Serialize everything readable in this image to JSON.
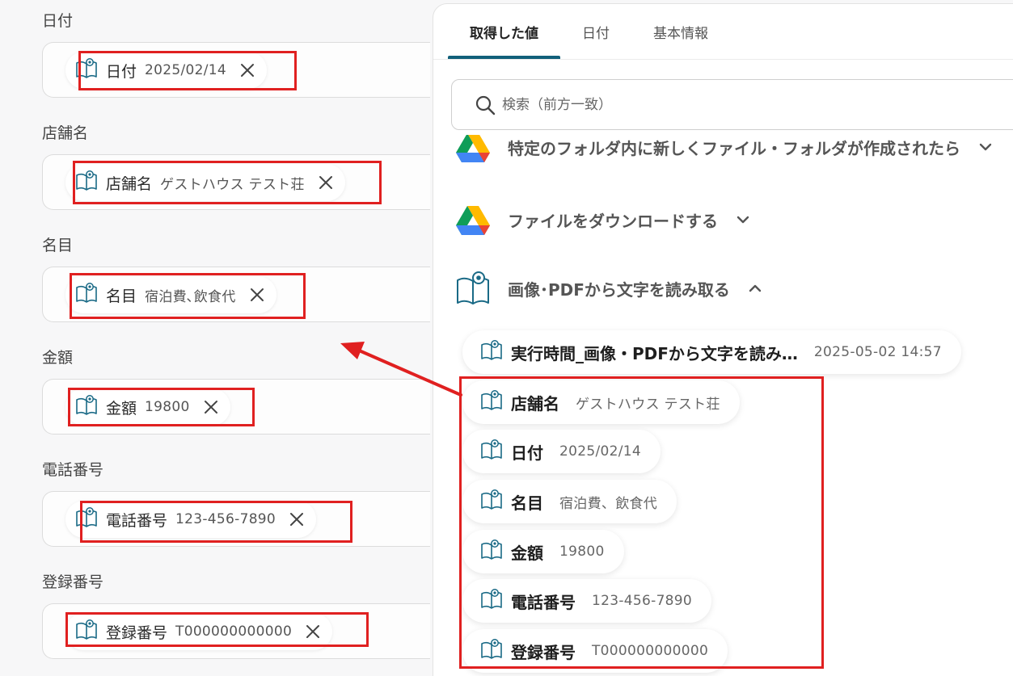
{
  "form": {
    "fields": [
      {
        "label": "日付",
        "chip_name": "日付",
        "chip_value": "2025/02/14"
      },
      {
        "label": "店舗名",
        "chip_name": "店舗名",
        "chip_value": "ゲストハウス テスト荘"
      },
      {
        "label": "名目",
        "chip_name": "名目",
        "chip_value": "宿泊費､飲食代"
      },
      {
        "label": "金額",
        "chip_name": "金額",
        "chip_value": "19800"
      },
      {
        "label": "電話番号",
        "chip_name": "電話番号",
        "chip_value": "123-456-7890"
      },
      {
        "label": "登録番号",
        "chip_name": "登録番号",
        "chip_value": "T000000000000"
      }
    ]
  },
  "panel": {
    "tabs": [
      {
        "label": "取得した値",
        "active": true
      },
      {
        "label": "日付",
        "active": false
      },
      {
        "label": "基本情報",
        "active": false
      }
    ],
    "search": {
      "placeholder": "検索（前方一致）"
    },
    "sections": [
      {
        "title": "特定のフォルダ内に新しくファイル・フォルダが作成されたら",
        "icon": "google-drive-icon",
        "expanded": false
      },
      {
        "title": "ファイルをダウンロードする",
        "icon": "google-drive-icon",
        "expanded": false
      },
      {
        "title": "画像･PDFから文字を読み取る",
        "icon": "ocr-book-icon",
        "expanded": true
      }
    ],
    "outputs": [
      {
        "name": "実行時間_画像・PDFから文字を読み…",
        "value": "2025-05-02 14:57"
      },
      {
        "name": "店舗名",
        "value": "ゲストハウス テスト荘"
      },
      {
        "name": "日付",
        "value": "2025/02/14"
      },
      {
        "name": "名目",
        "value": "宿泊費、飲食代"
      },
      {
        "name": "金額",
        "value": "19800"
      },
      {
        "name": "電話番号",
        "value": "123-456-7890"
      },
      {
        "name": "登録番号",
        "value": "T000000000000"
      }
    ]
  },
  "colors": {
    "highlight": "#e02020",
    "tab_accent": "#11607a",
    "ocr_icon": "#1a6a86"
  }
}
